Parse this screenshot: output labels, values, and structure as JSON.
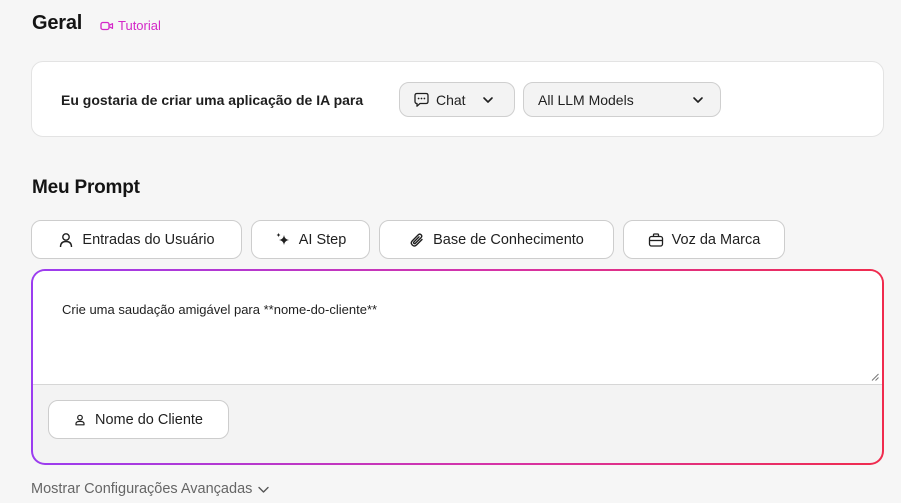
{
  "geral": {
    "title": "Geral",
    "tutorial_label": "Tutorial",
    "accent_color": "#d428c8"
  },
  "app_config": {
    "sentence": "Eu gostaria de criar uma aplicação de IA para",
    "app_type_selected": "Chat",
    "model_selected": "All LLM Models"
  },
  "prompt": {
    "title": "Meu Prompt",
    "tools": [
      {
        "label": "Entradas do Usuário",
        "icon": "user-icon"
      },
      {
        "label": "AI Step",
        "icon": "sparkle-icon"
      },
      {
        "label": "Base de Conhecimento",
        "icon": "paperclip-icon"
      },
      {
        "label": "Voz da Marca",
        "icon": "briefcase-icon"
      }
    ],
    "text": "Crie uma saudação amigável para **nome-do-cliente**",
    "variable_chip": "Nome do Cliente",
    "gradient_colors": [
      "#9b3cf0",
      "#d633a6",
      "#f02b4d"
    ]
  },
  "advanced": {
    "label": "Mostrar Configurações Avançadas"
  }
}
